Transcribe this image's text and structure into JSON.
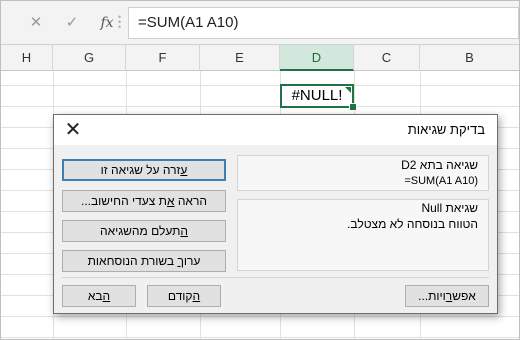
{
  "formula_bar": {
    "cancel_icon": "✕",
    "enter_icon": "✓",
    "fx_label": "fx",
    "formula": "=SUM(A1 A10)"
  },
  "columns": [
    "H",
    "G",
    "F",
    "E",
    "D",
    "C",
    "B"
  ],
  "selected_column": "D",
  "active_cell": {
    "value": "#NULL!"
  },
  "dialog": {
    "title": "בדיקת שגיאות",
    "close_icon": "✕",
    "cell_label": "שגיאה בתא D2",
    "cell_formula": "=SUM(A1 A10)",
    "error_title": "שגיאת Null",
    "error_description": "הטווח בנוסחה לא מצטלב.",
    "buttons": {
      "help": {
        "pre": "",
        "hot": "ע",
        "post": "זרה על שגיאה זו"
      },
      "show_steps": {
        "pre": "הראה ",
        "hot": "א",
        "post": "ת צעדי החישוב..."
      },
      "ignore": {
        "pre": "",
        "hot": "ה",
        "post": "תעלם מהשגיאה"
      },
      "edit": {
        "pre": "ערו",
        "hot": "ך",
        "post": " בשורת הנוסחאות"
      },
      "options": {
        "pre": "אפש",
        "hot": "ר",
        "post": "ויות..."
      },
      "previous": {
        "pre": "",
        "hot": "ה",
        "post": "קודם"
      },
      "next": {
        "pre": "",
        "hot": "ה",
        "post": "בא"
      }
    }
  }
}
